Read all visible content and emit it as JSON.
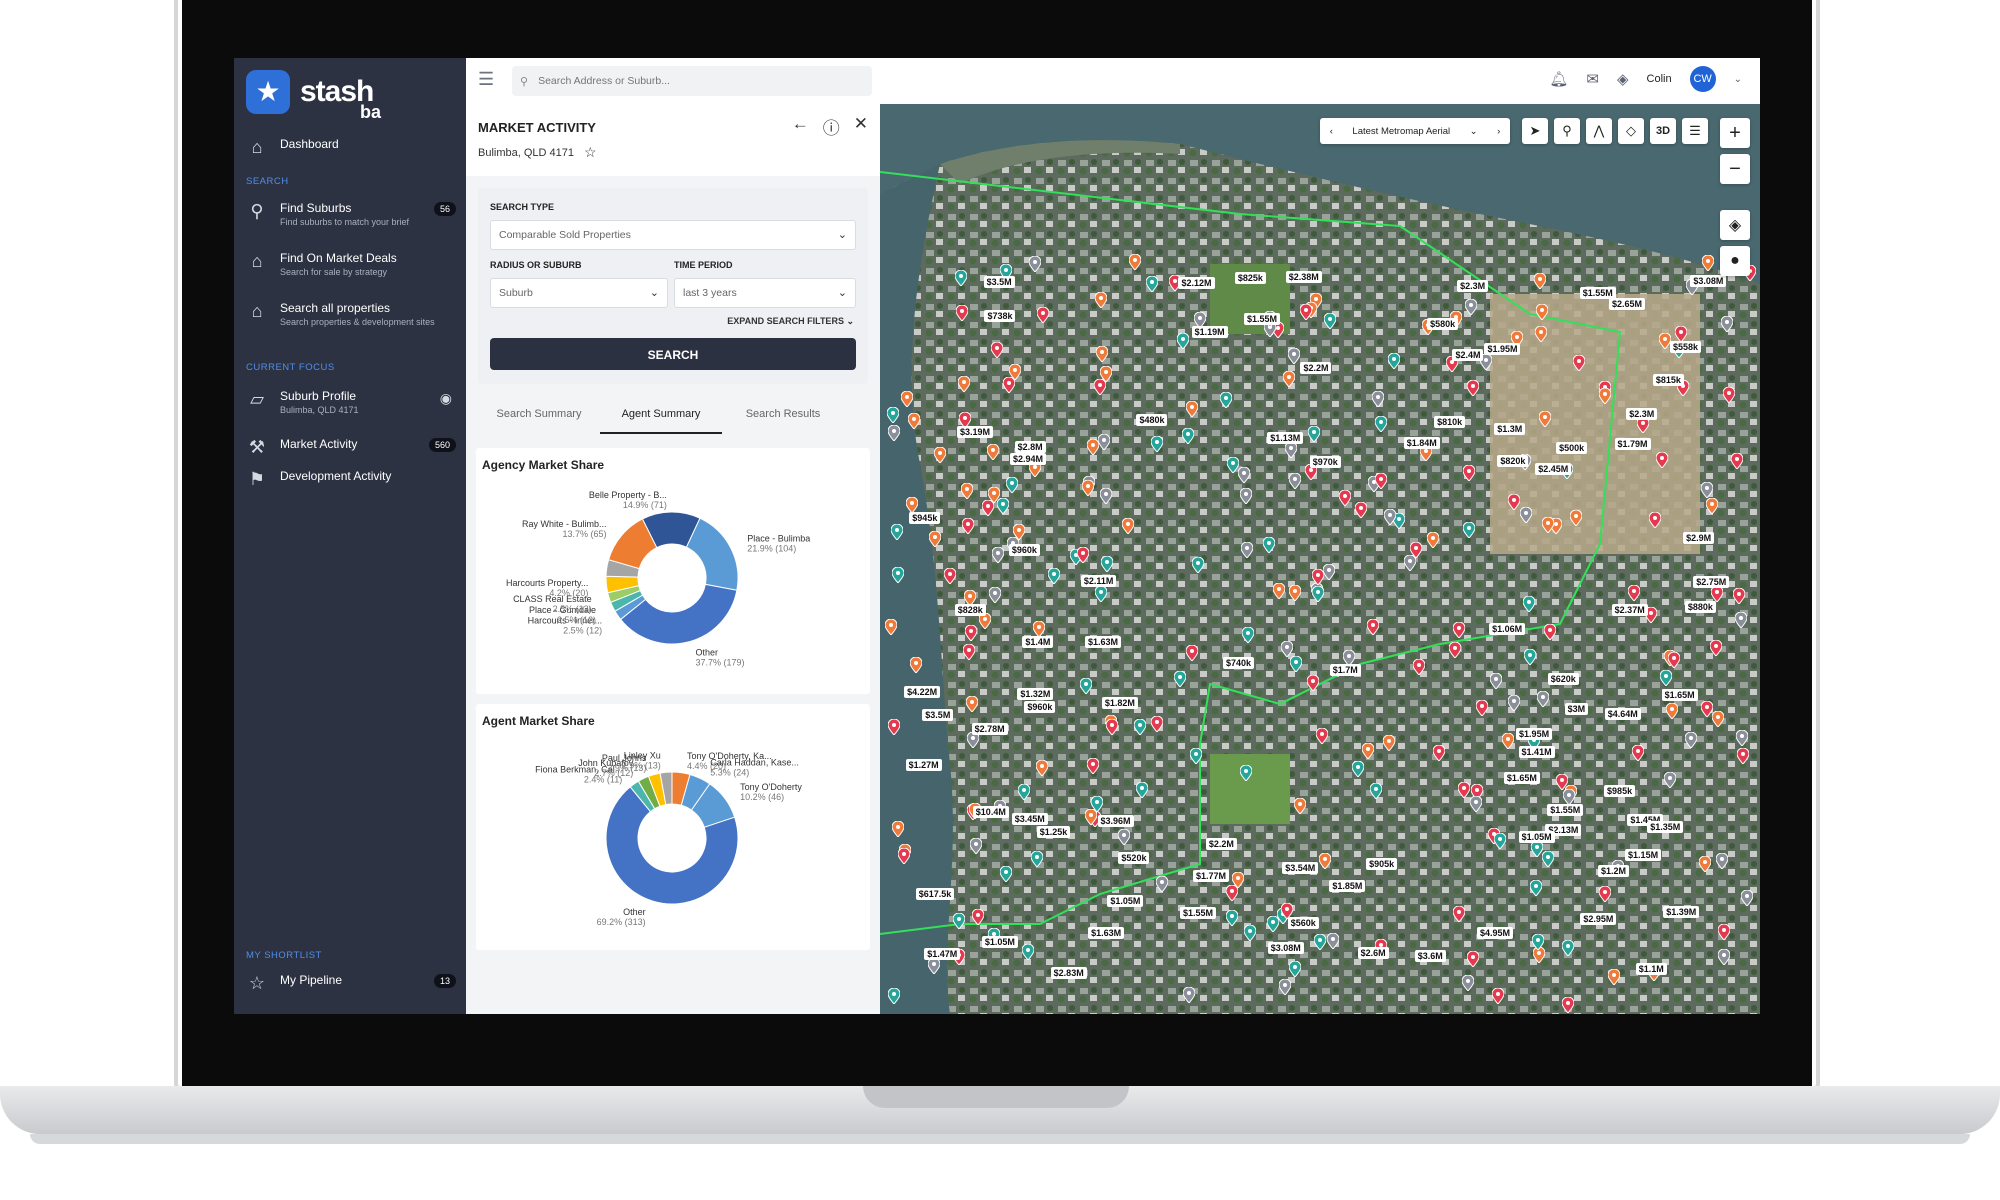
{
  "app": {
    "brand": "stash",
    "brand_sub": "ba"
  },
  "sidebar": {
    "dashboard": "Dashboard",
    "search_section": "SEARCH",
    "items": [
      {
        "label": "Find Suburbs",
        "sub": "Find suburbs to match your brief",
        "badge": "56"
      },
      {
        "label": "Find On Market Deals",
        "sub": "Search for sale by strategy",
        "badge": ""
      },
      {
        "label": "Search all properties",
        "sub": "Search properties & development sites",
        "badge": ""
      }
    ],
    "focus_section": "CURRENT FOCUS",
    "focus_items": [
      {
        "label": "Suburb Profile",
        "sub": "Bulimba, QLD 4171",
        "badge": ""
      },
      {
        "label": "Market Activity",
        "sub": "",
        "badge": "560"
      },
      {
        "label": "Development Activity",
        "sub": "",
        "badge": ""
      }
    ],
    "shortlist_section": "MY SHORTLIST",
    "shortlist_items": [
      {
        "label": "My Pipeline",
        "badge": "13"
      }
    ]
  },
  "topbar": {
    "search_placeholder": "Search Address or Suburb...",
    "user_name": "Colin",
    "user_initials": "CW"
  },
  "panel": {
    "title": "MARKET ACTIVITY",
    "location": "Bulimba, QLD 4171",
    "search_type_label": "SEARCH TYPE",
    "search_type_value": "Comparable Sold Properties",
    "radius_label": "RADIUS OR SUBURB",
    "radius_value": "Suburb",
    "time_label": "TIME PERIOD",
    "time_value": "last 3 years",
    "expand_filters": "EXPAND SEARCH FILTERS",
    "search_button": "SEARCH",
    "tabs": [
      "Search Summary",
      "Agent Summary",
      "Search Results"
    ],
    "active_tab": "Agent Summary"
  },
  "chart_data": [
    {
      "type": "pie",
      "title": "Agency Market Share",
      "slices": [
        {
          "label": "Place - Bulimba",
          "pct_label": "21.9% (104)",
          "value": 21.9,
          "color": "#5b9bd5"
        },
        {
          "label": "Other",
          "pct_label": "37.7% (179)",
          "value": 37.7,
          "color": "#4472c4"
        },
        {
          "label": "Harcourts - Inner...",
          "pct_label": "2.5% (12)",
          "value": 2.5,
          "color": "#5a9bd5"
        },
        {
          "label": "Place - Gumdale",
          "pct_label": "2.5% (12)",
          "value": 2.5,
          "color": "#4db6ac"
        },
        {
          "label": "CLASS Real Estate",
          "pct_label": "2.5% (12)",
          "value": 2.5,
          "color": "#9ccc65"
        },
        {
          "label": "Harcourts Property...",
          "pct_label": "4.2% (20)",
          "value": 4.2,
          "color": "#ffc000"
        },
        {
          "label": "",
          "pct_label": "",
          "value": 4.2,
          "color": "#a5a5a5"
        },
        {
          "label": "Ray White - Bulimb...",
          "pct_label": "13.7% (65)",
          "value": 13.7,
          "color": "#ed7d31"
        },
        {
          "label": "Belle Property - B...",
          "pct_label": "14.9% (71)",
          "value": 14.9,
          "color": "#2f5597"
        }
      ]
    },
    {
      "type": "pie",
      "title": "Agent Market Share",
      "slices": [
        {
          "label": "Tony O'Doherty, Ka...",
          "pct_label": "4.4% (20)",
          "value": 4.4,
          "color": "#ed7d31"
        },
        {
          "label": "Carla Haddan, Kase...",
          "pct_label": "5.3% (24)",
          "value": 5.3,
          "color": "#5b9bd5"
        },
        {
          "label": "Tony O'Doherty",
          "pct_label": "10.2% (46)",
          "value": 10.2,
          "color": "#5b9bd5"
        },
        {
          "label": "Other",
          "pct_label": "69.2% (313)",
          "value": 69.2,
          "color": "#4472c4"
        },
        {
          "label": "Fiona Berkman, Cal...",
          "pct_label": "2.4% (11)",
          "value": 2.4,
          "color": "#4db6ac"
        },
        {
          "label": "John Kubatov",
          "pct_label": "2.7% (12)",
          "value": 2.7,
          "color": "#70ad47"
        },
        {
          "label": "Paul Johns",
          "pct_label": "2.9% (13)",
          "value": 2.9,
          "color": "#ffc000"
        },
        {
          "label": "Linley Xu",
          "pct_label": "2.9% (13)",
          "value": 2.9,
          "color": "#a5a5a5"
        }
      ]
    }
  ],
  "map": {
    "layer": "Latest Metromap Aerial",
    "tools": [
      "select-icon",
      "pin-icon",
      "route-icon",
      "polygon-icon",
      "3D",
      "list-icon"
    ],
    "zoom_in": "+",
    "zoom_out": "−",
    "prices": [
      "$3.6M",
      "$2.78M",
      "$3M",
      "$3.5M",
      "$2.94M",
      "$2.4M",
      "$1.06M",
      "$1.39M",
      "$1.55M",
      "$1.05M",
      "$1.2M",
      "$2.2M",
      "$1.13M",
      "$2.11M",
      "$4.64M",
      "$3.45M",
      "$2.12M",
      "$1.05M",
      "$3.54M",
      "$2.6M",
      "$2.95M",
      "$2.13M",
      "$1.63M",
      "$3.08M",
      "$3.08M",
      "$580k",
      "$4.22M",
      "$1.95M",
      "$2.83M",
      "$1.63M",
      "$3.19M",
      "$1.4M",
      "$945k",
      "$2.3M",
      "$2.65M",
      "$810k",
      "$2.9M",
      "$4.95M",
      "$1.85M",
      "$1.82M",
      "$2.75M",
      "$1.65M",
      "$1.55M",
      "$1.47M",
      "$3.96M",
      "$3.5M",
      "$1.25k",
      "$1.65M",
      "$1.55M",
      "$820k",
      "$1.55M",
      "$1.1M",
      "$10.4M",
      "$1.3M",
      "$1.32M",
      "$1.7M",
      "$2.37M",
      "$1.19M",
      "$825k",
      "$905k",
      "$1.15M",
      "$828k",
      "$960k",
      "$738k",
      "$500k",
      "$815k",
      "$480k",
      "$1.27M",
      "$520k",
      "$620k",
      "$558k",
      "$560k",
      "$880k",
      "$617.5k",
      "$1.45M",
      "$2.8M",
      "$970k",
      "$985k",
      "$1.84M",
      "$1.41M",
      "$1.95M",
      "$1.05M",
      "$960k",
      "$2.45M",
      "$2.3M",
      "$1.35M",
      "$740k",
      "$1.77M",
      "$2.2M",
      "$1.79M",
      "$2.38M"
    ]
  },
  "colors": {
    "sidebar": "#2d3242",
    "accent": "#2e6fd8",
    "boundary": "#32e05a"
  }
}
